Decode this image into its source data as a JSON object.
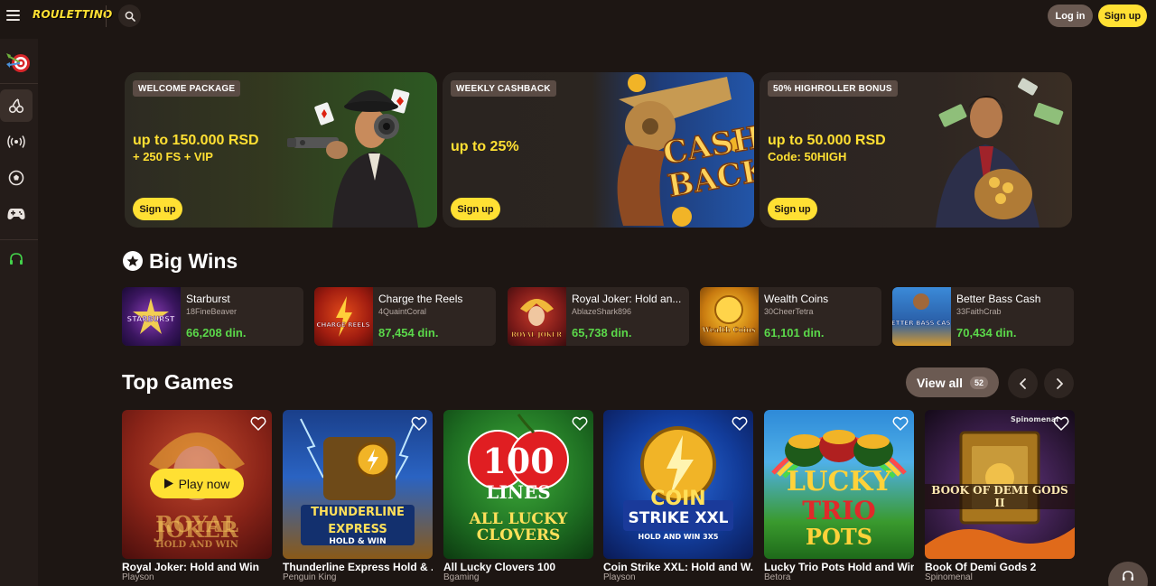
{
  "header": {
    "logo_text": "ROULETTINO",
    "login_label": "Log in",
    "signup_label": "Sign up",
    "icons": [
      "hamburger-icon",
      "search-icon"
    ]
  },
  "sidebar": {
    "items": [
      {
        "name": "darts-casino",
        "icon": "darts-target-icon"
      },
      {
        "name": "slots",
        "icon": "cherries-icon",
        "active": true
      },
      {
        "name": "live",
        "icon": "broadcast-icon"
      },
      {
        "name": "sports",
        "icon": "soccer-ball-icon"
      },
      {
        "name": "games",
        "icon": "gamepad-icon"
      },
      {
        "name": "support",
        "icon": "headset-icon"
      }
    ]
  },
  "promos": [
    {
      "tag": "WELCOME PACKAGE",
      "title": "up to 150.000 RSD",
      "subtitle": "+ 250 FS + VIP",
      "button": "Sign up"
    },
    {
      "tag": "WEEKLY CASHBACK",
      "title": "up to 25%",
      "subtitle": "",
      "button": "Sign up",
      "art_text_1": "CASH",
      "art_text_2": "BACK"
    },
    {
      "tag": "50% HIGHROLLER BONUS",
      "title": "up to 50.000 RSD",
      "subtitle": "Code: 50HIGH",
      "button": "Sign up"
    }
  ],
  "big_wins": {
    "title": "Big Wins",
    "items": [
      {
        "game": "Starburst",
        "user": "18FineBeaver",
        "amount": "66,208 din.",
        "thumb_text": "STARBURST"
      },
      {
        "game": "Charge the Reels",
        "user": "4QuaintCoral",
        "amount": "87,454 din.",
        "thumb_text": "CHARGE REELS"
      },
      {
        "game": "Royal Joker: Hold an...",
        "user": "AblazeShark896",
        "amount": "65,738 din.",
        "thumb_text": "ROYAL JOKER"
      },
      {
        "game": "Wealth Coins",
        "user": "30CheerTetra",
        "amount": "61,101 din.",
        "thumb_text": "Wealth Coins"
      },
      {
        "game": "Better Bass Cash",
        "user": "33FaithCrab",
        "amount": "70,434 din.",
        "thumb_text": "BETTER BASS CASH"
      }
    ]
  },
  "top_games": {
    "title": "Top Games",
    "view_all_label": "View all",
    "view_all_count": "52",
    "play_now_label": "Play now",
    "items": [
      {
        "title": "Royal Joker: Hold and Win",
        "provider": "Playson",
        "thumb_line_1": "ROYAL",
        "thumb_line_2": "JOKER",
        "thumb_line_3": "HOLD AND WIN"
      },
      {
        "title": "Thunderline Express Hold & ...",
        "provider": "Penguin King",
        "thumb_line_1": "THUNDERLINE",
        "thumb_line_2": "EXPRESS",
        "thumb_line_3": "HOLD & WIN"
      },
      {
        "title": "All Lucky Clovers 100",
        "provider": "Bgaming",
        "thumb_line_1": "100",
        "thumb_line_2": "LINES",
        "thumb_line_3": "ALL LUCKY CLOVERS"
      },
      {
        "title": "Coin Strike XXL: Hold and W...",
        "provider": "Playson",
        "thumb_line_1": "COIN",
        "thumb_line_2": "STRIKE XXL",
        "thumb_line_3": "HOLD AND WIN 3X5"
      },
      {
        "title": "Lucky Trio Pots Hold and Win",
        "provider": "Betora",
        "thumb_line_1": "LUCKY",
        "thumb_line_2": "TRIO",
        "thumb_line_3": "POTS"
      },
      {
        "title": "Book Of Demi Gods 2",
        "provider": "Spinomenal",
        "thumb_line_1": "BOOK OF DEMI GODS II",
        "thumb_line_2": "Spinomenal",
        "thumb_line_3": ""
      }
    ]
  },
  "colors": {
    "background": "#1d1613",
    "accent_yellow": "#ffe033",
    "win_green": "#5bd84a",
    "card": "#2e2521",
    "button_brown": "#6b5a52"
  }
}
